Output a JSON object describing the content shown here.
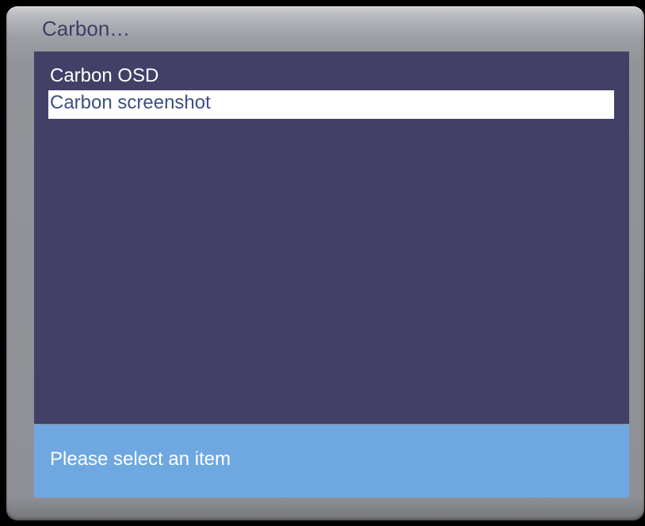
{
  "dialog": {
    "title": "Carbon…"
  },
  "list": {
    "selected_index": 1,
    "items": [
      {
        "label": "Carbon OSD"
      },
      {
        "label": "Carbon screenshot"
      }
    ]
  },
  "status": {
    "text": "Please select an item"
  },
  "colors": {
    "list_background": "#424066",
    "selected_background": "#ffffff",
    "selected_text": "#3e4f82",
    "status_background": "#6fa8e0",
    "title_text": "#3f3d66"
  }
}
